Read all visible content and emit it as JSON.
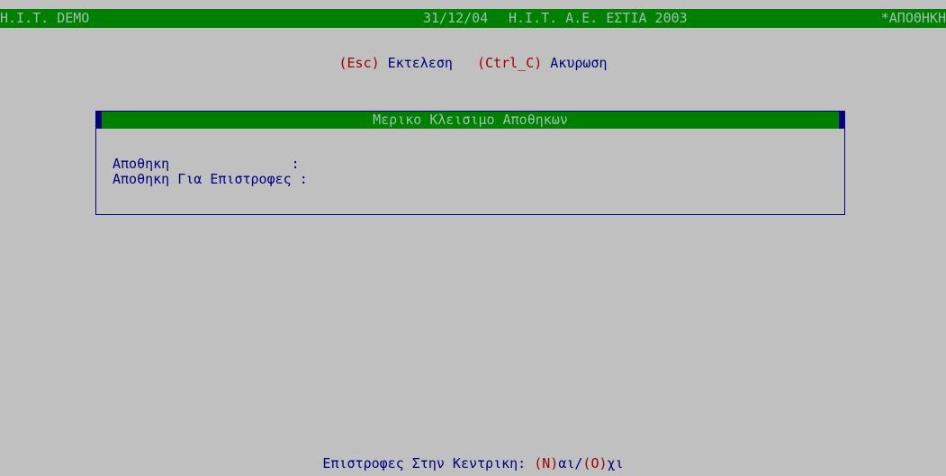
{
  "titlebar": {
    "left": "H.I.T. DEMO",
    "date": "31/12/04",
    "company": "H.I.T. A.E. ΕΣΤΙΑ 2003",
    "module": "*ΑΠΟΘΗΚΗ"
  },
  "hint": {
    "key1": "(Esc)",
    "action1": "Εκτελεση",
    "key2": "(Ctrl_C)",
    "action2": "Ακυρωση"
  },
  "panel": {
    "title": "Μερικο Κλεισιμο Αποθηκων",
    "fields": [
      {
        "label": "Αποθηκη               :",
        "value": ""
      },
      {
        "label": "Αποθηκη Για Επιστροφες :",
        "value": ""
      }
    ]
  },
  "prompt": {
    "question": "Επιστροφες Στην Κεντρικη:",
    "yes_key": "(N)",
    "yes_rest": "αι/",
    "no_key": "(O)",
    "no_rest": "χι"
  },
  "colors": {
    "background": "#c0c0c0",
    "bar": "#008000",
    "text": "#000080",
    "key": "#a00000",
    "bar_text": "#9fbfb0"
  }
}
